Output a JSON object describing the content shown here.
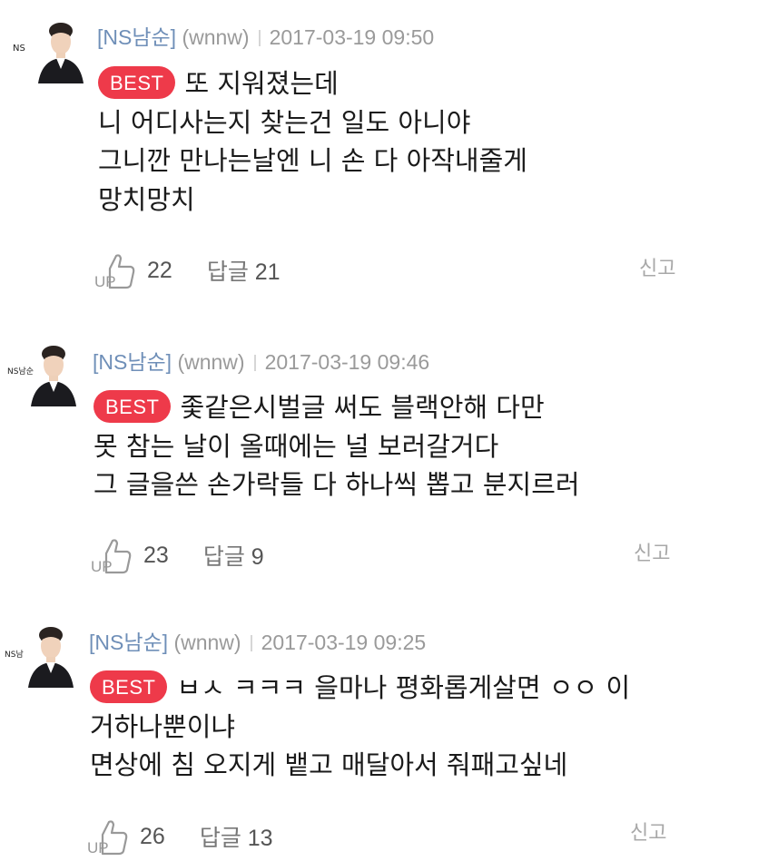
{
  "comments": [
    {
      "nick": "[NS남순]",
      "user_id": "(wnnw)",
      "date": "2017-03-19 09:50",
      "best_label": "BEST",
      "lines": [
        "또 지워졌는데",
        "니 어디사는지 찾는건 일도 아니야",
        "그니깐 만나는날엔 니 손 다 아작내줄게",
        "망치망치"
      ],
      "likes": "22",
      "reply_label": "답글",
      "reply_count": "21",
      "report_label": "신고",
      "avatar_text": "NS"
    },
    {
      "nick": "[NS남순]",
      "user_id": "(wnnw)",
      "date": "2017-03-19 09:46",
      "best_label": "BEST",
      "lines": [
        "좇같은시벌글 써도 블랙안해 다만",
        "못 참는 날이 올때에는 널 보러갈거다",
        "그 글을쓴 손가락들 다 하나씩 뽑고 분지르러"
      ],
      "likes": "23",
      "reply_label": "답글",
      "reply_count": "9",
      "report_label": "신고",
      "avatar_text": "NS남순"
    },
    {
      "nick": "[NS남순]",
      "user_id": "(wnnw)",
      "date": "2017-03-19 09:25",
      "best_label": "BEST",
      "lines": [
        "ㅂㅅ ㅋㅋㅋ 을마나 평화롭게살면 ㅇㅇ 이",
        "거하나뿐이냐",
        "면상에 침 오지게 뱉고 매달아서 줘패고싶네"
      ],
      "likes": "26",
      "reply_label": "답글",
      "reply_count": "13",
      "report_label": "신고",
      "avatar_text": "NS남"
    }
  ],
  "colors": {
    "best_badge": "#ee3a4a",
    "nickname": "#6f8fb8",
    "meta": "#9a9a9a"
  },
  "icons": {
    "up": "thumbs-up-icon",
    "avatar": "profile-avatar"
  }
}
